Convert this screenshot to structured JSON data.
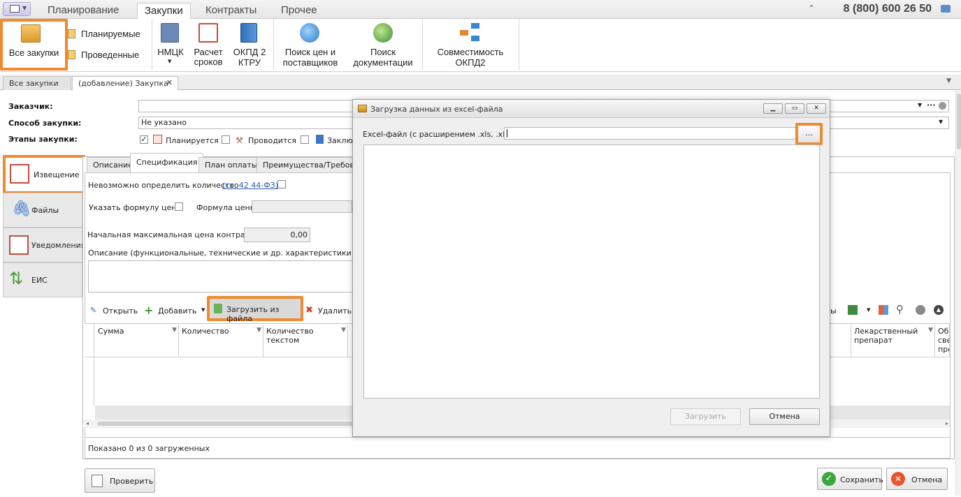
{
  "menu": {
    "tabs": [
      "Планирование",
      "Закупки",
      "Контракты",
      "Прочее"
    ],
    "phone": "8 (800) 600 26 50"
  },
  "ribbon": {
    "all": "Все закупки",
    "planned": "Планируемые",
    "done": "Проведенные",
    "nmck": "НМЦК",
    "calc": "Расчет сроков",
    "okpd_a": "ОКПД 2",
    "okpd_b": "КТРУ",
    "price_a": "Поиск цен и",
    "price_b": "поставщиков",
    "doc_a": "Поиск",
    "doc_b": "документации",
    "comp_a": "Совместимость",
    "comp_b": "ОКПД2"
  },
  "doctabs": {
    "t1": "Все закупки",
    "t2": "(добавление) Закупка"
  },
  "form": {
    "customer": "Заказчик:",
    "method": "Способ закупки:",
    "method_value": "Не указано",
    "stages": "Этапы закупки:",
    "st1": "Планируется",
    "st2": "Проводится",
    "st3": "Заклю"
  },
  "side": {
    "s1": "Извещение",
    "s2": "Файлы",
    "s3": "Уведомления",
    "s4": "ЕИС"
  },
  "subtabs": {
    "t1": "Описание",
    "t2": "Спецификация",
    "t3": "План оплаты",
    "t4": "Преимущества/Требован"
  },
  "spec": {
    "qty": "Невозможно определить количество",
    "law": "(ст. 42 44-ФЗ)",
    "formula_chk": "Указать формулу цены",
    "formula": "Формула цены",
    "nmck_label": "Начальная максимальная цена контракта",
    "nmck_value": "0,00",
    "desc": "Описание (функциональные, технические и др. характеристики):"
  },
  "toolbar": {
    "open": "Открыть",
    "add": "Добавить",
    "load": "Загрузить из файла",
    "del": "Удалить",
    "cut": "ы"
  },
  "grid": {
    "c1": "Сумма",
    "c2": "Количество",
    "c3a": "Количество",
    "c3b": "текстом",
    "c4a": "Лекарственный",
    "c4b": "препарат",
    "c5a": "Обо",
    "c5b": "све",
    "c5c": "преп",
    "status": "Показано 0 из 0 загруженных"
  },
  "bottom": {
    "check": "Проверить",
    "save": "Сохранить",
    "cancel": "Отмена"
  },
  "dialog": {
    "title": "Загрузка данных из excel-файла",
    "label": "Excel-файл (с расширением .xls, .xlsx):",
    "browse": "...",
    "load": "Загрузить",
    "cancel": "Отмена"
  }
}
